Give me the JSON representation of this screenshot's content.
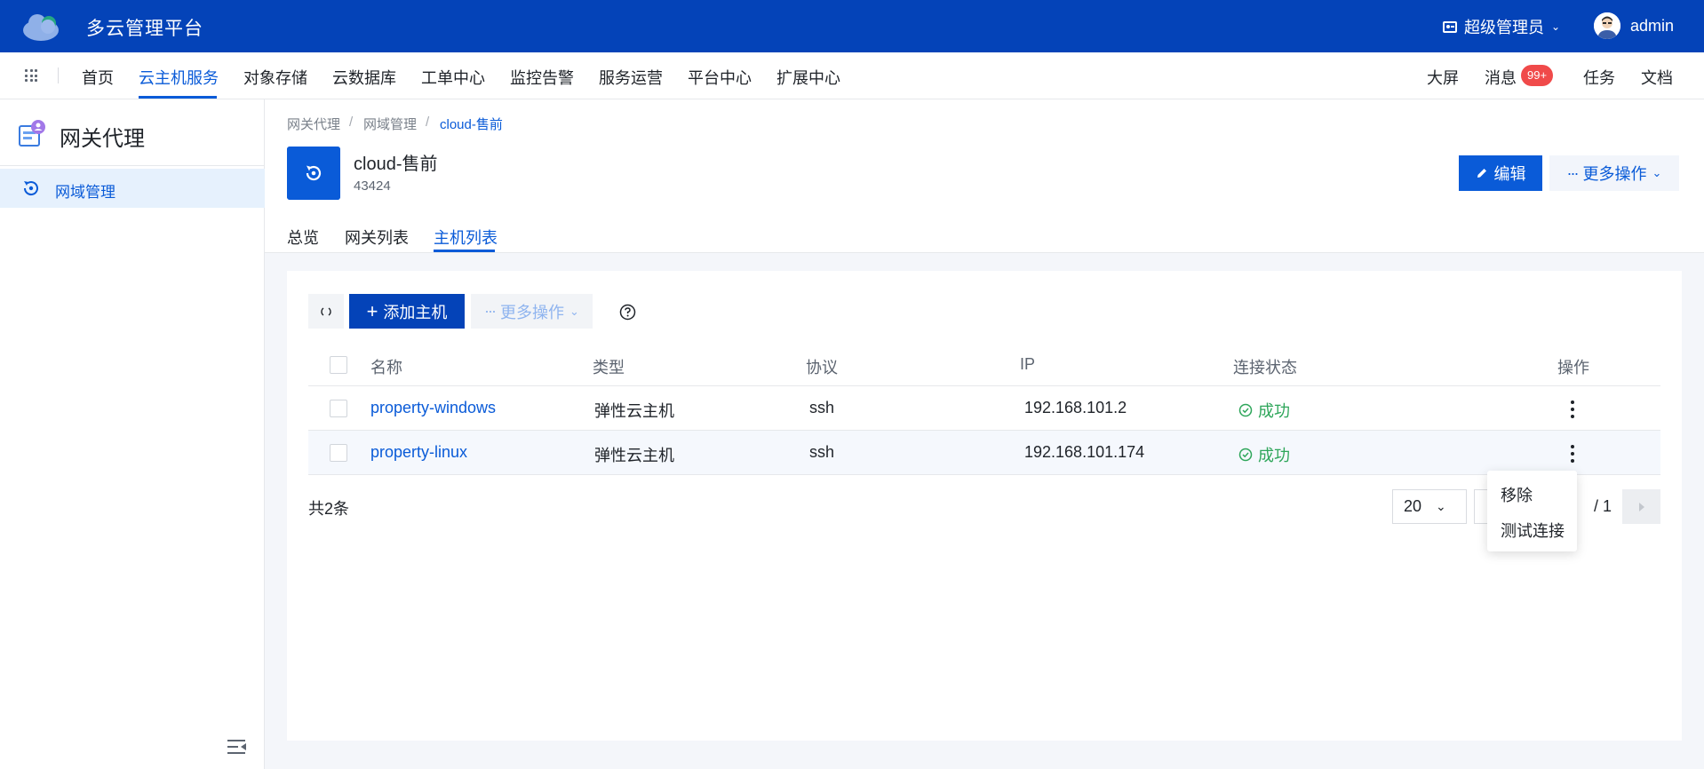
{
  "topbar": {
    "brand": "多云管理平台",
    "role": "超级管理员",
    "username": "admin"
  },
  "nav": {
    "items": [
      "首页",
      "云主机服务",
      "对象存储",
      "云数据库",
      "工单中心",
      "监控告警",
      "服务运营",
      "平台中心",
      "扩展中心"
    ],
    "active": "云主机服务",
    "right": {
      "bigscreen": "大屏",
      "messages": "消息",
      "messages_badge": "99+",
      "tasks": "任务",
      "docs": "文档"
    }
  },
  "sidebar": {
    "title": "网关代理",
    "items": [
      {
        "label": "网域管理",
        "active": true
      }
    ]
  },
  "breadcrumb": [
    "网关代理",
    "网域管理",
    "cloud-售前"
  ],
  "resource": {
    "name": "cloud-售前",
    "id": "43424",
    "edit_label": "编辑",
    "more_label": "更多操作"
  },
  "tabs": [
    {
      "label": "总览"
    },
    {
      "label": "网关列表"
    },
    {
      "label": "主机列表",
      "active": true
    }
  ],
  "toolbar": {
    "add_label": "添加主机",
    "more_label": "更多操作"
  },
  "table": {
    "headers": [
      "名称",
      "类型",
      "协议",
      "IP",
      "连接状态",
      "操作"
    ],
    "rows": [
      {
        "name": "property-windows",
        "type": "弹性云主机",
        "protocol": "ssh",
        "ip": "192.168.101.2",
        "status": "成功"
      },
      {
        "name": "property-linux",
        "type": "弹性云主机",
        "protocol": "ssh",
        "ip": "192.168.101.174",
        "status": "成功"
      }
    ]
  },
  "pagination": {
    "total": "共2条",
    "page_size": "20",
    "page_total": "/ 1"
  },
  "row_menu": {
    "items": [
      "移除",
      "测试连接"
    ]
  },
  "colors": {
    "topbar": "#0443b8",
    "primary": "#0a5bd8",
    "success": "#2ea65a",
    "badge": "#f04a4a"
  }
}
